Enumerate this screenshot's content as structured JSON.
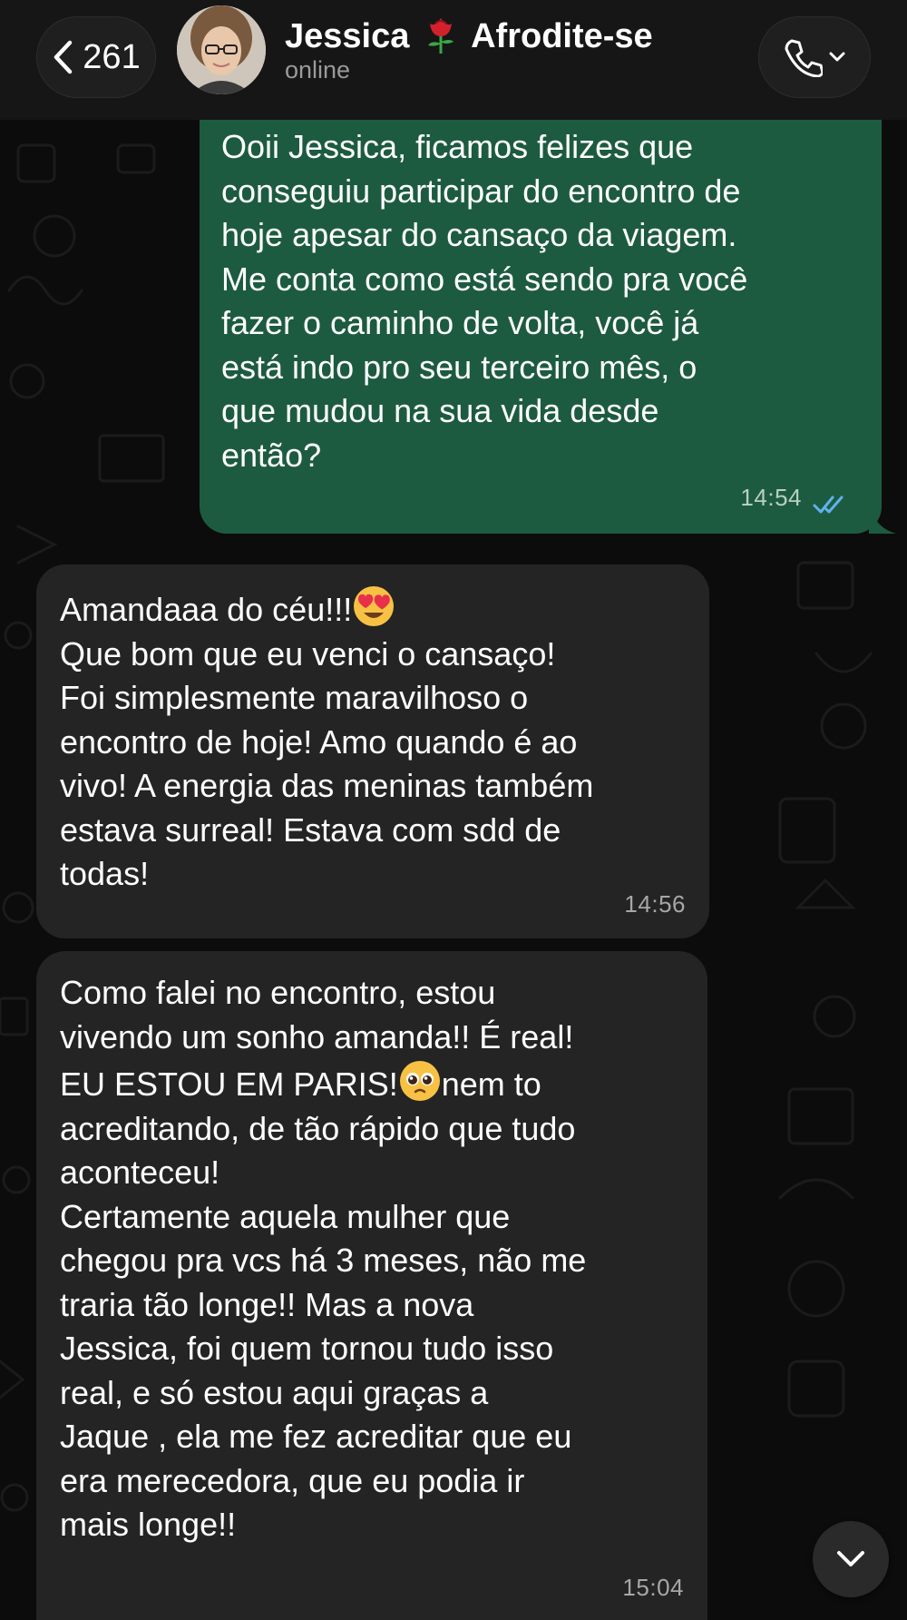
{
  "header": {
    "back_count": "261",
    "contact_name_part1": "Jessica",
    "contact_name_part2": "Afrodite-se",
    "status": "online"
  },
  "messages": [
    {
      "direction": "outgoing",
      "text": "Ooii Jessica, ficamos felizes que\nconseguiu participar do encontro de\nhoje apesar do cansaço da viagem.\nMe conta como está sendo pra você\nfazer o caminho de volta, você já\nestá indo pro seu terceiro mês, o\nque mudou na sua vida desde\nentão?",
      "time": "14:54",
      "read": true
    },
    {
      "direction": "incoming",
      "line1": "Amandaaa do céu!!!",
      "text": "Que bom que eu venci o cansaço!\nFoi simplesmente maravilhoso o\nencontro de hoje! Amo quando é ao\nvivo! A energia das meninas também\nestava surreal! Estava com sdd de\ntodas!",
      "time": "14:56"
    },
    {
      "direction": "incoming",
      "text_before": "Como falei no encontro, estou\nvivendo um sonho amanda!! É real!\nEU ESTOU EM PARIS!",
      "text_after_emoji": "nem to",
      "text": "acreditando, de tão rápido que tudo\naconteceu!\nCertamente aquela mulher que\nchegou pra vcs há 3 meses, não me\ntraria tão longe!! Mas a nova\nJessica, foi quem tornou tudo isso\nreal, e só estou aqui graças a\nJaque , ela me fez acreditar que eu\nera merecedora, que eu podia ir\nmais longe!!",
      "time": "15:04"
    }
  ],
  "icons": {
    "back": "chevron-left-icon",
    "call": "phone-icon",
    "call_menu": "chevron-down-icon",
    "scroll": "chevron-down-icon",
    "rose": "rose-emoji",
    "heart_eyes": "heart-eyes-emoji",
    "pleading": "pleading-face-emoji",
    "read_receipt": "double-check-icon"
  },
  "colors": {
    "outgoing_bubble": "#1d5b40",
    "incoming_bubble": "#242424",
    "read_tick": "#5fb3ec",
    "background": "#0b0b0b"
  }
}
